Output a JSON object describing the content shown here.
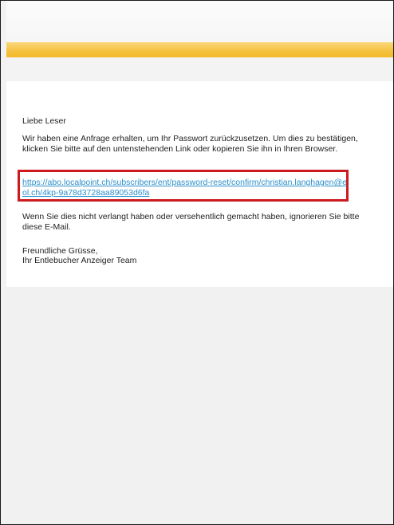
{
  "email": {
    "greeting": "Liebe Leser",
    "intro": "Wir haben eine Anfrage erhalten, um Ihr Passwort zurückzusetzen. Um dies zu bestätigen, klicken Sie bitte auf den untenstehenden Link oder kopieren Sie ihn in Ihren Browser.",
    "reset_link": "https://abo.localpoint.ch/subscribers/ent/password-reset/confirm/christian.langhagen@eol.ch/4kp-9a78d3728aa89053d6fa",
    "notice": "Wenn Sie dies nicht verlangt haben oder versehentlich gemacht haben, ignorieren Sie bitte diese E-Mail.",
    "closing": "Freundliche Grüsse,",
    "signature": "Ihr Entlebucher Anzeiger Team"
  },
  "colors": {
    "accent": "#f5c13d",
    "highlight_border": "#cc1a1f",
    "link": "#2b8fc9"
  }
}
